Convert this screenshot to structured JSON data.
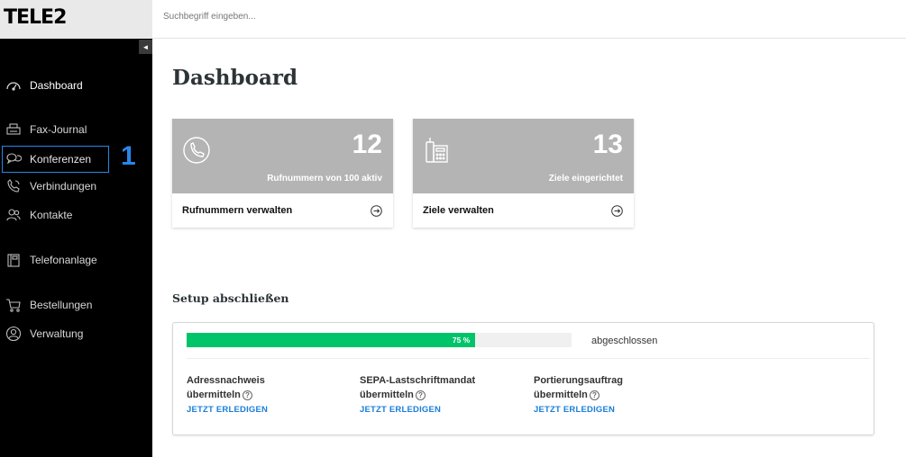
{
  "brand": {
    "logo_text": "TELE2"
  },
  "search": {
    "placeholder": "Suchbegriff eingeben..."
  },
  "sidebar": {
    "collapse_glyph": "◄",
    "items": [
      {
        "label": "Dashboard",
        "icon": "speedometer-icon"
      },
      {
        "label": "Fax-Journal",
        "icon": "fax-icon"
      },
      {
        "label": "Konferenzen",
        "icon": "chat-bubbles-icon"
      },
      {
        "label": "Verbindungen",
        "icon": "phone-signal-icon"
      },
      {
        "label": "Kontakte",
        "icon": "contacts-icon"
      },
      {
        "label": "Telefonanlage",
        "icon": "phone-system-icon"
      },
      {
        "label": "Bestellungen",
        "icon": "cart-icon"
      },
      {
        "label": "Verwaltung",
        "icon": "user-circle-icon"
      }
    ],
    "marker": "1"
  },
  "main": {
    "title": "Dashboard",
    "cards": [
      {
        "number": "12",
        "subtitle": "Rufnummern von 100 aktiv",
        "link": "Rufnummern verwalten",
        "icon": "phone-circle-icon"
      },
      {
        "number": "13",
        "subtitle": "Ziele eingerichtet",
        "link": "Ziele verwalten",
        "icon": "desk-phone-icon"
      }
    ],
    "setup": {
      "title": "Setup abschließen",
      "progress_percent": 75,
      "progress_text": "75 %",
      "progress_label": "abgeschlossen",
      "tasks": [
        {
          "line1": "Adressnachweis",
          "line2": "übermitteln",
          "action": "JETZT ERLEDIGEN"
        },
        {
          "line1": "SEPA-Lastschriftmandat",
          "line2": "übermitteln",
          "action": "JETZT ERLEDIGEN"
        },
        {
          "line1": "Portierungsauftrag",
          "line2": "übermitteln",
          "action": "JETZT ERLEDIGEN"
        }
      ]
    }
  },
  "colors": {
    "accent": "#2a86e8",
    "progress": "#00c46a",
    "link": "#1a7ed8",
    "card_top": "#b4b4b4",
    "sidebar": "#000000"
  }
}
